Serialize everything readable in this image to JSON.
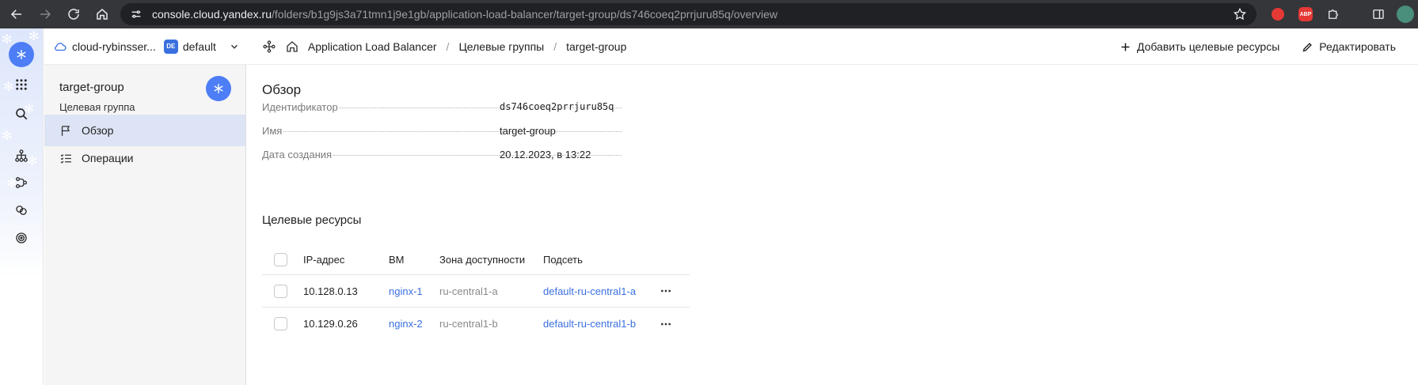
{
  "browser": {
    "url_host": "console.cloud.yandex.ru",
    "url_path": "/folders/b1g9js3a71tmn1j9e1gb/application-load-balancer/target-group/ds746coeq2prrjuru85q/overview",
    "ext_abp_label": "ABP"
  },
  "header": {
    "cloud_name": "cloud-rybinsser...",
    "folder_badge": "DE",
    "folder_name": "default",
    "breadcrumbs": [
      {
        "label": "Application Load Balancer"
      },
      {
        "label": "Целевые группы"
      },
      {
        "label": "target-group"
      }
    ],
    "actions": {
      "add_targets": "Добавить целевые ресурсы",
      "edit": "Редактировать"
    }
  },
  "panel": {
    "title": "target-group",
    "subtitle": "Целевая группа",
    "menu": [
      {
        "label": "Обзор"
      },
      {
        "label": "Операции"
      }
    ]
  },
  "overview": {
    "title": "Обзор",
    "fields": [
      {
        "key": "Идентификатор",
        "value": "ds746coeq2prrjuru85q"
      },
      {
        "key": "Имя",
        "value": "target-group"
      },
      {
        "key": "Дата создания",
        "value": "20.12.2023, в 13:22"
      }
    ]
  },
  "targets": {
    "title": "Целевые ресурсы",
    "columns": {
      "ip": "IP-адрес",
      "vm": "ВМ",
      "zone": "Зона доступности",
      "subnet": "Подсеть"
    },
    "rows": [
      {
        "ip": "10.128.0.13",
        "vm": "nginx-1",
        "zone": "ru-central1-a",
        "subnet": "default-ru-central1-a"
      },
      {
        "ip": "10.129.0.26",
        "vm": "nginx-2",
        "zone": "ru-central1-b",
        "subnet": "default-ru-central1-b"
      }
    ]
  },
  "colors": {
    "accent": "#4d7ef6",
    "link": "#3a6fe0",
    "active_menu_bg": "#dde4f5",
    "chrome_bg": "#35363a"
  }
}
